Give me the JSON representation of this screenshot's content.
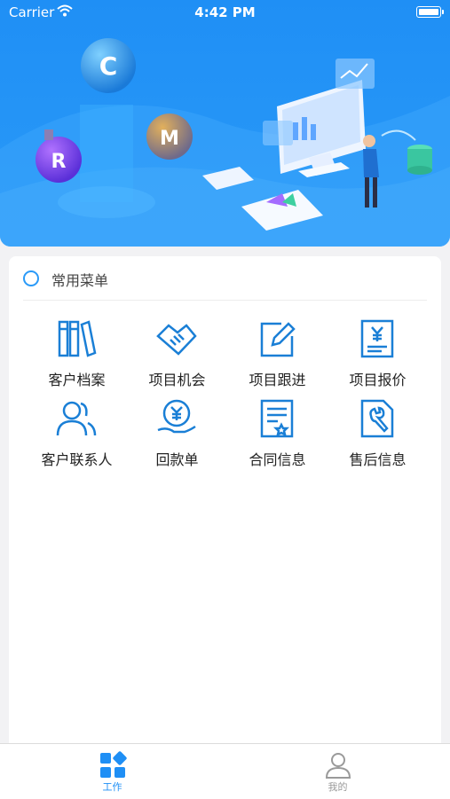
{
  "status_bar": {
    "carrier": "Carrier",
    "time": "4:42 PM"
  },
  "banner": {
    "balls": [
      "C",
      "M",
      "R"
    ]
  },
  "common_menu": {
    "title": "常用菜单",
    "items": [
      {
        "label": "客户档案",
        "icon": "books-icon"
      },
      {
        "label": "项目机会",
        "icon": "handshake-icon"
      },
      {
        "label": "项目跟进",
        "icon": "edit-icon"
      },
      {
        "label": "项目报价",
        "icon": "price-document-icon"
      },
      {
        "label": "客户联系人",
        "icon": "contacts-icon"
      },
      {
        "label": "回款单",
        "icon": "payment-hand-icon"
      },
      {
        "label": "合同信息",
        "icon": "contract-icon"
      },
      {
        "label": "售后信息",
        "icon": "after-sales-wrench-icon"
      }
    ]
  },
  "tabbar": {
    "tabs": [
      {
        "label": "工作",
        "icon": "grid-icon",
        "active": true
      },
      {
        "label": "我的",
        "icon": "user-icon",
        "active": false
      }
    ]
  },
  "colors": {
    "accent": "#1f8ff5",
    "icon": "#1a7fd6",
    "inactive": "#9a9a9a"
  }
}
